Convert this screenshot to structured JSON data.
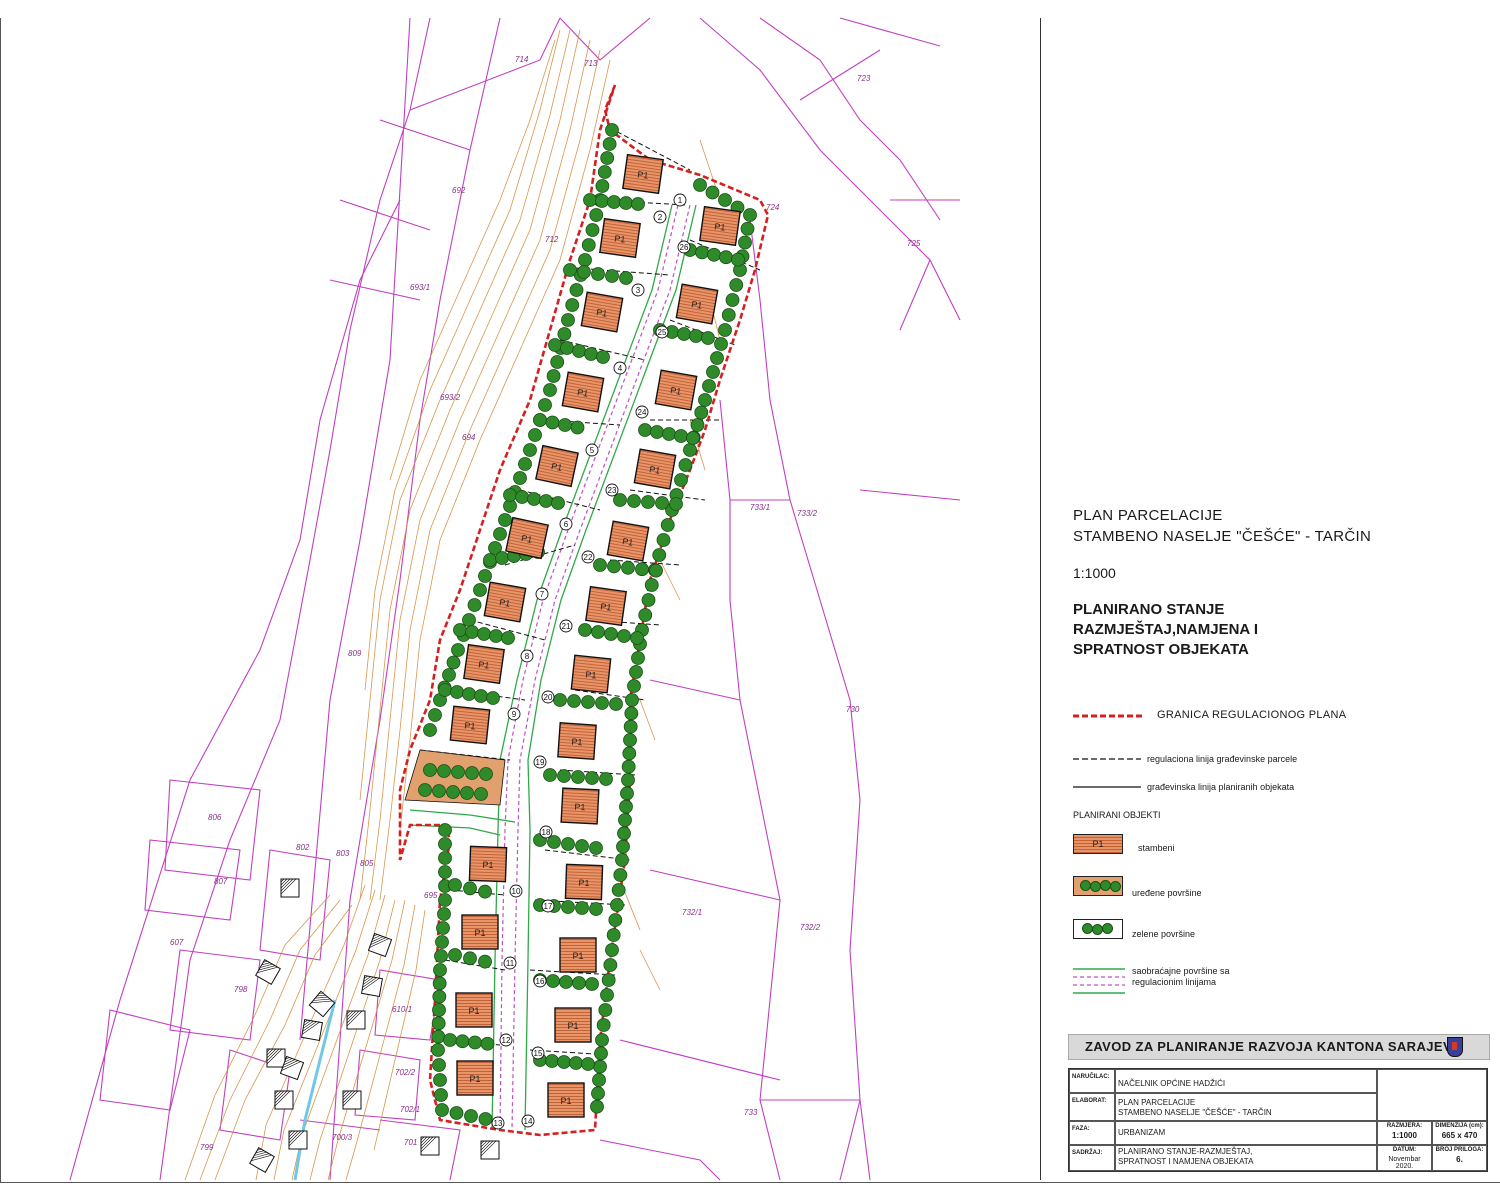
{
  "title_block": {
    "title_line1": "PLAN PARCELACIJE",
    "title_line2": "STAMBENO NASELJE \"ČEŠĆE\" - TARČIN",
    "scale": "1:1000",
    "heading_line1": "PLANIRANO STANJE",
    "heading_line2": "RAZMJEŠTAJ,NAMJENA I",
    "heading_line3": "SPRATNOST OBJEKATA"
  },
  "legend": {
    "plan_boundary": "GRANICA REGULACIONOG PLANA",
    "parcel_line": "regulaciona linija građevinske parcele",
    "building_line": "građevinska linija planiranih objekata",
    "planned_objects_title": "PLANIRANI OBJEKTI",
    "residential_tag": "P1",
    "residential": "stambeni",
    "landscaped": "uređene površine",
    "green": "zelene površine",
    "traffic_line1": "saobraćajne površine sa",
    "traffic_line2": "regulacionim linijama"
  },
  "colors": {
    "boundary": "#d42020",
    "cadastre": "#c040c0",
    "contour": "#d58a3a",
    "building_fill": "#e07a48",
    "tree": "#2f8a2a",
    "road": "#c050c0"
  },
  "institute": "ZAVOD ZA PLANIRANJE RAZVOJA KANTONA SARAJEVO",
  "info_table": {
    "narucilac_label": "NARUČILAC:",
    "narucilac": "NAČELNIK OPĆINE HADŽIĆI",
    "elaborat_label": "ELABORAT:",
    "elaborat_line1": "PLAN PARCELACIJE",
    "elaborat_line2": "STAMBENO NASELJE \"ČEŠĆE\" - TARČIN",
    "faza_label": "FAZA:",
    "faza": "URBANIZAM",
    "sadrzaj_label": "SADRŽAJ:",
    "sadrzaj_line1": "PLANIRANO STANJE-RAZMJEŠTAJ,",
    "sadrzaj_line2": "SPRATNOST I NAMJENA OBJEKATA",
    "razmjera_label": "RAZMJERA:",
    "razmjera": "1:1000",
    "dimenzija_label": "DIMENZIJA (cm):",
    "dimenzija": "665 x 470",
    "datum_label": "DATUM:",
    "datum": "Novembar 2020.",
    "broj_priloga_label": "BROJ PRILOGA:",
    "broj_priloga": "6."
  },
  "map": {
    "building_label": "P1",
    "parcel_numbers": [
      "714",
      "713",
      "723",
      "724",
      "725",
      "692",
      "712",
      "693/1",
      "693/2",
      "694",
      "733/1",
      "733/2",
      "809",
      "730",
      "806",
      "802",
      "803",
      "805",
      "807",
      "695",
      "607",
      "798",
      "732/1",
      "732/2",
      "733",
      "701",
      "702/2",
      "702/1",
      "700/3",
      "799",
      "610/1"
    ],
    "lot_numbers": [
      "1",
      "2",
      "3",
      "4",
      "5",
      "6",
      "7",
      "8",
      "9",
      "10",
      "11",
      "12",
      "13",
      "14",
      "15",
      "16",
      "17",
      "18",
      "19",
      "20",
      "21",
      "22",
      "23",
      "24",
      "25",
      "26"
    ]
  }
}
